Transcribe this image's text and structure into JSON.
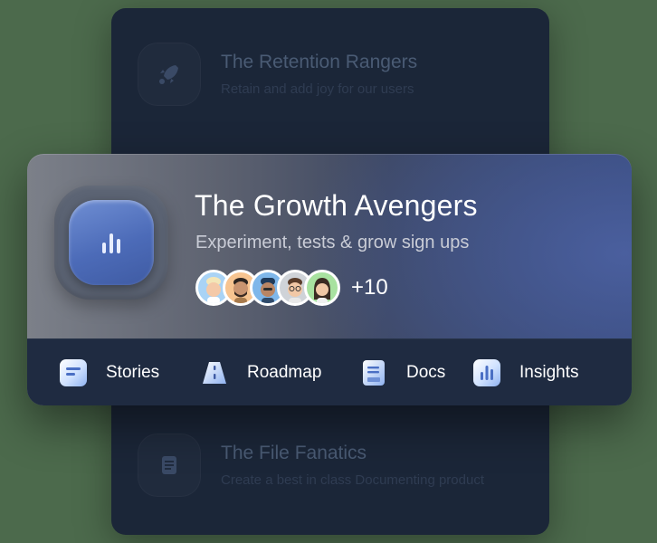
{
  "teams_behind": [
    {
      "name": "The Retention Rangers",
      "subtitle": "Retain and add joy for our users",
      "icon": "rocket-icon"
    },
    {
      "name": "The File Fanatics",
      "subtitle": "Create a best in class Documenting product",
      "icon": "document-icon"
    }
  ],
  "card": {
    "title": "The Growth Avengers",
    "subtitle": "Experiment, tests & grow sign ups",
    "icon": "bar-chart-icon",
    "members_more": "+10",
    "avatars": [
      {
        "bg": "#a9d3f5"
      },
      {
        "bg": "#f7c490"
      },
      {
        "bg": "#7fb7ea"
      },
      {
        "bg": "#cfd3d8"
      },
      {
        "bg": "#a8e2a0"
      }
    ]
  },
  "tabs": [
    {
      "label": "Stories",
      "icon": "lines-icon"
    },
    {
      "label": "Roadmap",
      "icon": "road-icon"
    },
    {
      "label": "Docs",
      "icon": "document-icon"
    },
    {
      "label": "Insights",
      "icon": "bar-chart-icon"
    }
  ],
  "colors": {
    "accent_blue": "#4c6bb8",
    "panel_dark": "#1b2638",
    "tab_bar": "#1f2b41"
  }
}
